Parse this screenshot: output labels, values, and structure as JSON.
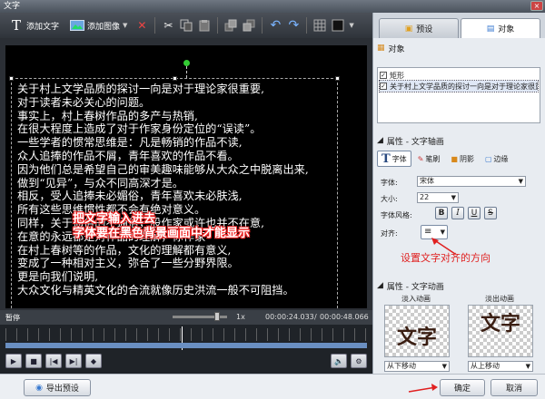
{
  "window": {
    "title": "文字",
    "close_label": "×"
  },
  "toolbar": {
    "add_text_icon": "text-T-icon",
    "add_text_label": "添加文字",
    "add_image_label": "添加图像",
    "delete_glyph": "✕",
    "cut_glyph": "✂",
    "undo_glyph": "↶",
    "redo_glyph": "↷"
  },
  "canvas": {
    "lines": [
      "关于村上文学品质的探讨一向是对于理论家很重要,",
      "对于读者未必关心的问题。",
      "事实上，村上春树作品的多产与热销,",
      "在很大程度上造成了对于作家身份定位的“误读”。",
      "一些学者的惯常思维是：凡是畅销的作品不读,",
      "众人追捧的作品不屑，青年喜欢的作品不看。",
      "因为他们总是希望自己的审美趣味能够从大众之中脱离出来,",
      "做到“见异”，与众不同高深才是。",
      "相反，受人追捧未必媚俗，青年喜欢未必肤浅,",
      "所有这些思维惯性都不会有绝对意义。",
      "同样，关于通俗的不通俗，股作家或许也并不在意,",
      "在意的永远都是对作品的理解，你作家",
      "在村上春树等的作品，文化的理解都有意义,",
      "变成了一种相对主义，弥合了一些分野界限。",
      "更是向我们说明,",
      "大众文化与精英文化的合流就像历史洪流一般不可阻挡。"
    ],
    "annotation_line1": "把文字输入进去",
    "annotation_line2": "字体要在黑色背景画面中才能显示"
  },
  "timeline": {
    "status": "暂停",
    "zoom_label": "1x",
    "current_time": "00:00:24.033",
    "total_time": "00:00:48.066"
  },
  "footer": {
    "export_preset_label": "导出预设",
    "ok_label": "确定",
    "cancel_label": "取消"
  },
  "panel": {
    "tabs": [
      {
        "label": "预设"
      },
      {
        "label": "对象"
      }
    ],
    "objects_header": "对象",
    "objects": [
      {
        "label": "矩形",
        "checked": true
      },
      {
        "label": "关于村上文学品质的探讨一向是对于理论家很重...",
        "checked": true
      }
    ],
    "props_header": "属性 - 文字轴画",
    "prop_tabs": [
      "字体",
      "笔刷",
      "阴影",
      "边缘"
    ],
    "font_label": "字体:",
    "font_value": "宋体",
    "size_label": "大小:",
    "size_value": "22",
    "style_label": "字体风格:",
    "bold": "B",
    "italic": "I",
    "underline": "U",
    "strike": "S",
    "align_label": "对齐:",
    "align_annotation": "设置文字对齐的方向",
    "anim_header": "属性 - 文字动画",
    "anim_in_label": "淡入动画",
    "anim_out_label": "淡出动画",
    "anim_thumb_text": "文字",
    "anim_in_value": "从下移动",
    "anim_out_value": "从上移动"
  },
  "colors": {
    "annotation": "#e02020",
    "canvas_bg": "#000000",
    "rotate_handle": "#33cc33"
  }
}
